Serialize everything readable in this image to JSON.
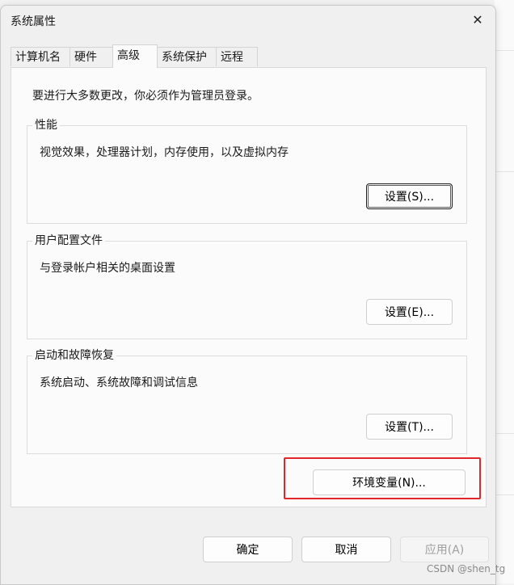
{
  "window": {
    "title": "系统属性",
    "close_icon": "close-icon"
  },
  "tabs": [
    {
      "label": "计算机名"
    },
    {
      "label": "硬件"
    },
    {
      "label": "高级",
      "active": true
    },
    {
      "label": "系统保护"
    },
    {
      "label": "远程"
    }
  ],
  "notice": "要进行大多数更改，你必须作为管理员登录。",
  "groups": {
    "performance": {
      "title": "性能",
      "description": "视觉效果，处理器计划，内存使用，以及虚拟内存",
      "button": "设置(S)..."
    },
    "user_profiles": {
      "title": "用户配置文件",
      "description": "与登录帐户相关的桌面设置",
      "button": "设置(E)..."
    },
    "startup_recovery": {
      "title": "启动和故障恢复",
      "description": "系统启动、系统故障和调试信息",
      "button": "设置(T)..."
    }
  },
  "env_button": "环境变量(N)...",
  "footer": {
    "ok": "确定",
    "cancel": "取消",
    "apply": "应用(A)"
  },
  "watermark": "CSDN @shen_tg",
  "colors": {
    "highlight": "#e3262b",
    "dialog_bg": "#f0f0f0",
    "panel_bg": "#fbfbfb"
  }
}
